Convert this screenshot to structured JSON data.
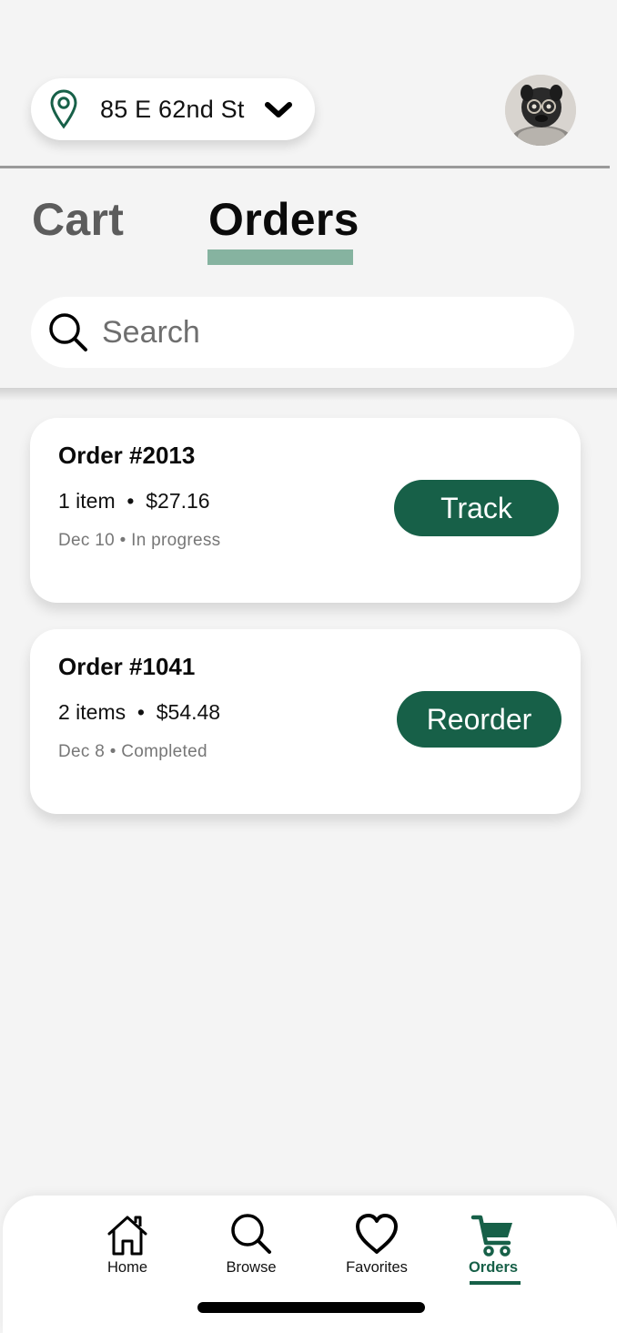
{
  "header": {
    "location": "85 E 62nd St",
    "brand_color": "#176048"
  },
  "tabs": [
    {
      "label": "Cart",
      "active": false
    },
    {
      "label": "Orders",
      "active": true
    }
  ],
  "search": {
    "placeholder": "Search"
  },
  "orders": [
    {
      "title": "Order #2013",
      "summary": "1 item  •  $27.16",
      "meta": "Dec 10 • In progress",
      "action_label": "Track"
    },
    {
      "title": "Order #1041",
      "summary": "2 items  •  $54.48",
      "meta": "Dec 8 • Completed",
      "action_label": "Reorder"
    }
  ],
  "bottom_nav": {
    "items": [
      {
        "label": "Home",
        "icon": "home-icon"
      },
      {
        "label": "Browse",
        "icon": "search-icon"
      },
      {
        "label": "Favorites",
        "icon": "heart-icon"
      },
      {
        "label": "Orders",
        "icon": "cart-icon",
        "active": true
      }
    ]
  }
}
